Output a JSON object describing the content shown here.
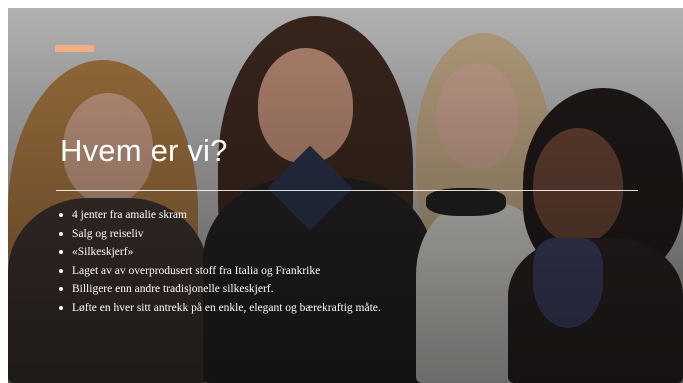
{
  "slide": {
    "title": "Hvem er vi?",
    "bullets": [
      "4 jenter fra amalie skram",
      "Salg og reiseliv",
      "«Silkeskjerf»",
      "Laget av av overprodusert stoff fra Italia og Frankrike",
      "Billigere enn andre tradisjonelle silkeskjerf.",
      "Løfte en hver sitt antrekk på en enkle, elegant og bærekraftig måte."
    ]
  },
  "colors": {
    "accent": "#f2ad84",
    "text": "#ffffff"
  }
}
